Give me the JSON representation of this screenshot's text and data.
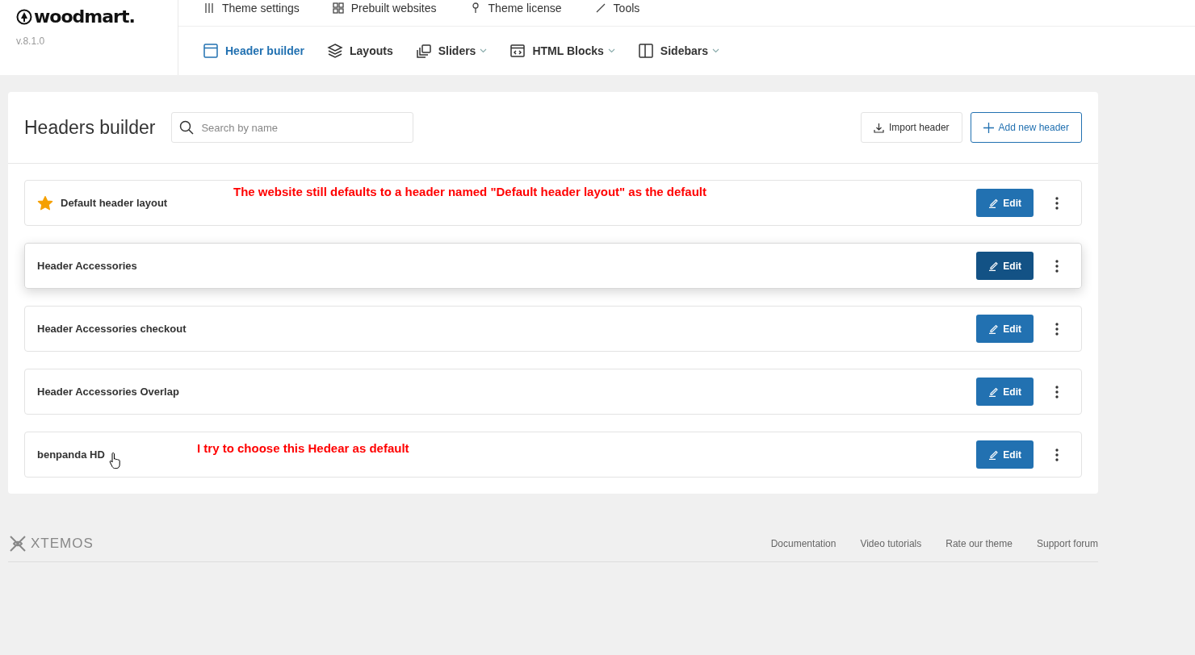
{
  "brand": {
    "name": "woodmart.",
    "version": "v.8.1.0"
  },
  "top_nav": [
    {
      "label": "Theme settings"
    },
    {
      "label": "Prebuilt websites"
    },
    {
      "label": "Theme license"
    },
    {
      "label": "Tools"
    }
  ],
  "sub_nav": [
    {
      "label": "Header builder",
      "selected": true,
      "dropdown": false
    },
    {
      "label": "Layouts",
      "selected": false,
      "dropdown": false
    },
    {
      "label": "Sliders",
      "selected": false,
      "dropdown": true
    },
    {
      "label": "HTML Blocks",
      "selected": false,
      "dropdown": true
    },
    {
      "label": "Sidebars",
      "selected": false,
      "dropdown": true
    }
  ],
  "page": {
    "title": "Headers builder",
    "search": {
      "placeholder": "Search by name"
    },
    "import_button": "Import header",
    "add_button": "Add new header"
  },
  "headers": [
    {
      "name": "Default header layout",
      "default": true,
      "hovered": false,
      "cursor": false,
      "edit": "Edit",
      "note": "The website still defaults to a header named \"Default header layout\" as the default"
    },
    {
      "name": "Header Accessories",
      "default": false,
      "hovered": true,
      "cursor": false,
      "edit": "Edit"
    },
    {
      "name": "Header Accessories checkout",
      "default": false,
      "hovered": false,
      "cursor": false,
      "edit": "Edit"
    },
    {
      "name": "Header Accessories Overlap",
      "default": false,
      "hovered": false,
      "cursor": false,
      "edit": "Edit"
    },
    {
      "name": "benpanda HD",
      "default": false,
      "hovered": false,
      "edit": "Edit",
      "note": "I try to choose this Hedear as default",
      "cursor": true
    }
  ],
  "footer": {
    "logo": "XTEMOS",
    "links": [
      "Documentation",
      "Video tutorials",
      "Rate our theme",
      "Support forum"
    ]
  }
}
